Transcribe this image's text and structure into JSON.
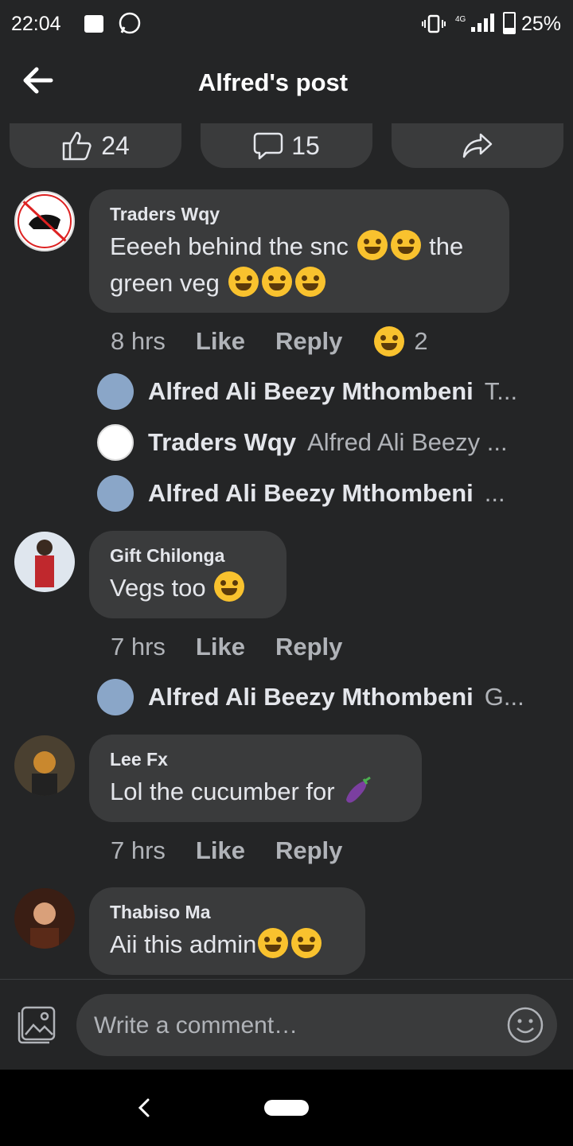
{
  "status_bar": {
    "time": "22:04",
    "network": "4G",
    "battery": "25%"
  },
  "header": {
    "title": "Alfred's post"
  },
  "actions": {
    "likes": "24",
    "comments": "15"
  },
  "comments": [
    {
      "name": "Traders Wqy",
      "text_before": "Eeeeh behind the snc",
      "text_mid": " the",
      "text_after": "green veg ",
      "time": "8 hrs",
      "like": "Like",
      "reply": "Reply",
      "reactions": "2",
      "replies": [
        {
          "name": "Alfred Ali Beezy Mthombeni",
          "text": "T..."
        },
        {
          "name": "Traders Wqy",
          "text": "Alfred Ali Beezy ..."
        },
        {
          "name": "Alfred Ali Beezy Mthombeni",
          "text": "..."
        }
      ]
    },
    {
      "name": "Gift Chilonga",
      "text": "Vegs  too ",
      "time": "7 hrs",
      "like": "Like",
      "reply": "Reply",
      "replies": [
        {
          "name": "Alfred Ali Beezy Mthombeni",
          "text": "G..."
        }
      ]
    },
    {
      "name": "Lee Fx",
      "text": "Lol the cucumber for ",
      "time": "7 hrs",
      "like": "Like",
      "reply": "Reply"
    },
    {
      "name": "Thabiso Ma",
      "text": "Aii this admin"
    }
  ],
  "composer": {
    "placeholder": "Write a comment…"
  },
  "icons": [
    "back-arrow-icon",
    "thumbs-up-icon",
    "comment-icon",
    "share-icon",
    "photo-icon",
    "emoji-icon"
  ]
}
